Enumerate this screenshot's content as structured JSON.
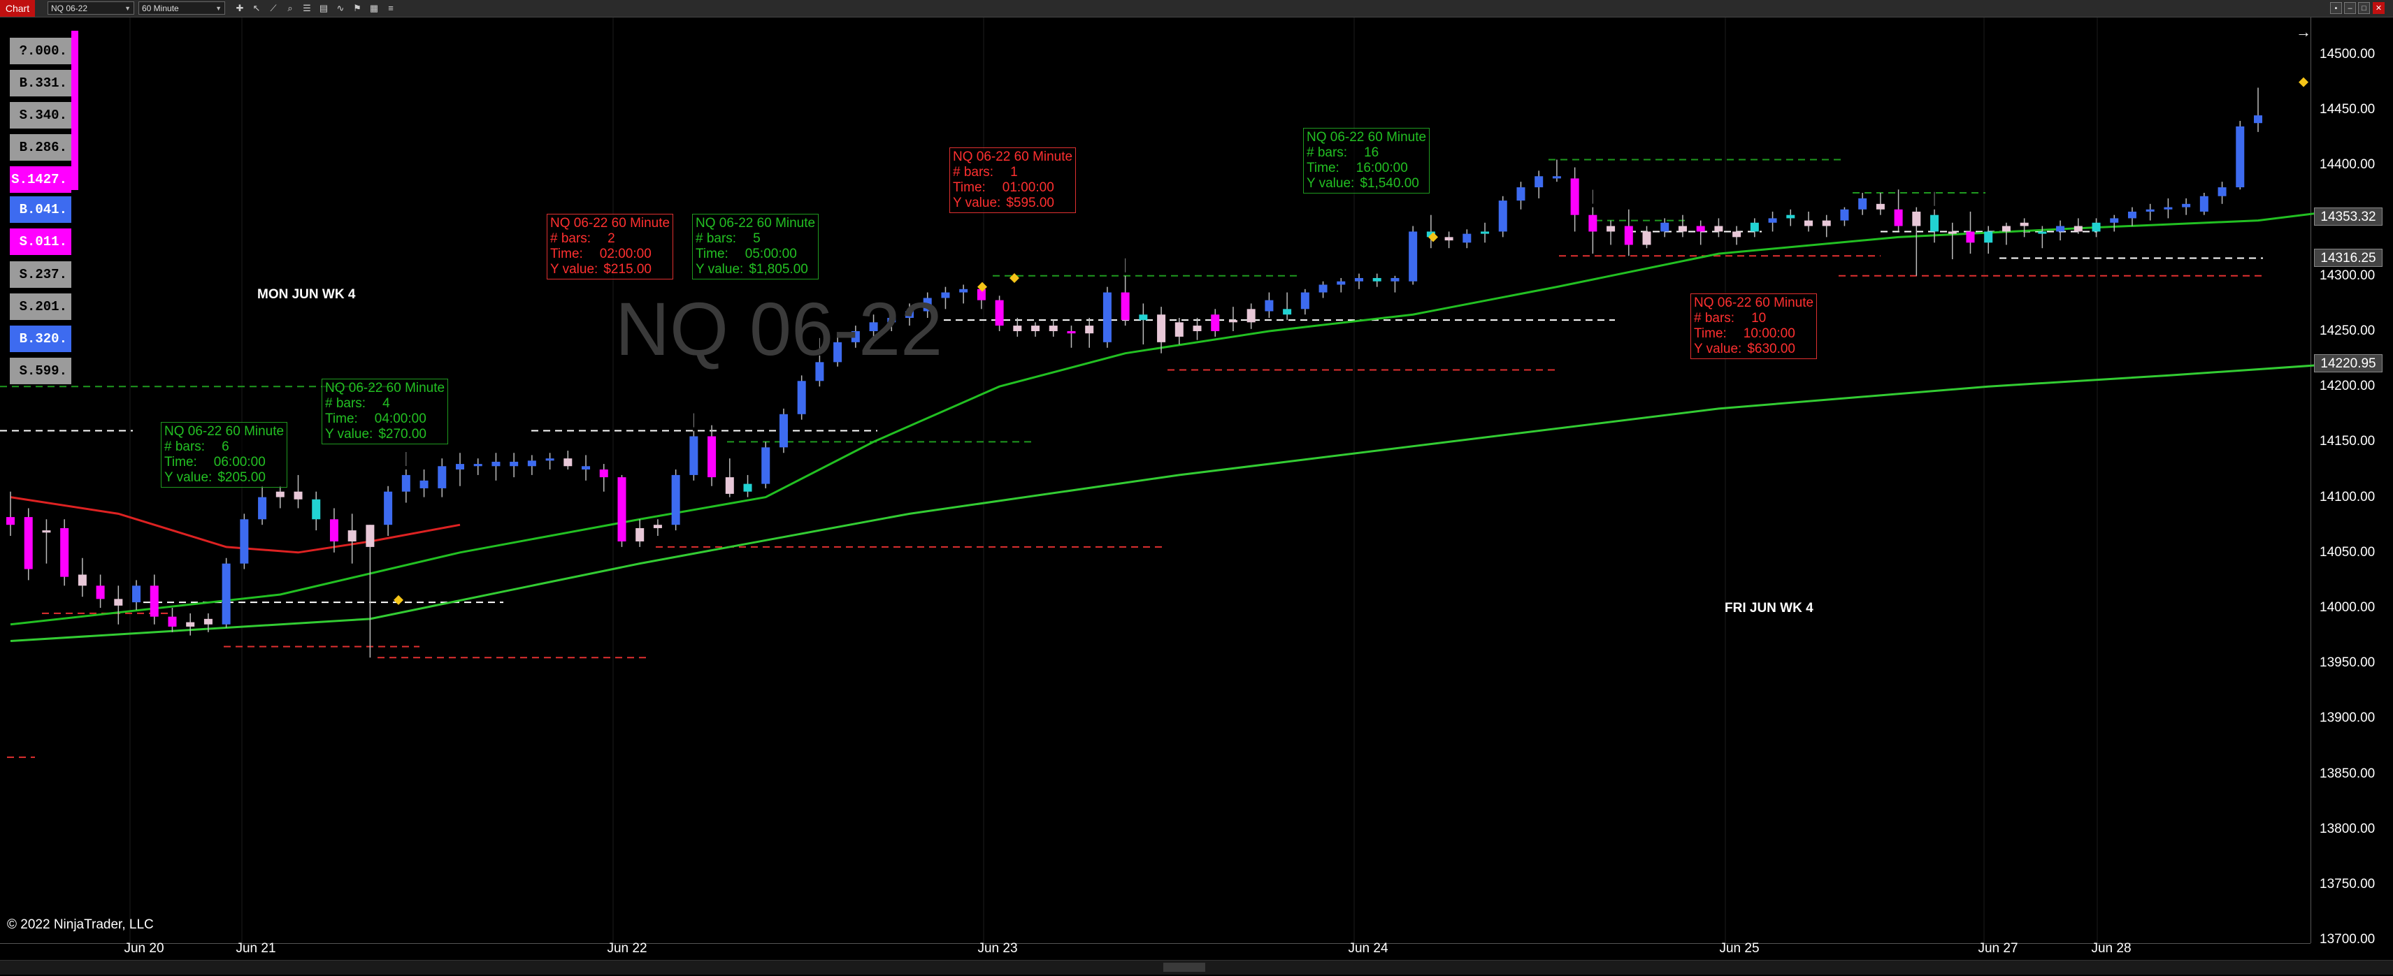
{
  "toolbar": {
    "tab_label": "Chart",
    "instrument": "NQ 06-22",
    "interval": "60 Minute",
    "tools": [
      "crosshair-icon",
      "pointer-icon",
      "draw-line-icon",
      "zoom-icon",
      "properties-icon",
      "data-series-icon",
      "indicators-icon",
      "strategies-icon",
      "templates-icon",
      "menu-icon"
    ]
  },
  "order_panel": [
    {
      "label": "?.000.",
      "type": "sell"
    },
    {
      "label": "B.331.",
      "type": "sell"
    },
    {
      "label": "S.340.",
      "type": "sell"
    },
    {
      "label": "B.286.",
      "type": "sell"
    },
    {
      "label": "S.1427.",
      "type": "magenta"
    },
    {
      "label": "B.041.",
      "type": "buy"
    },
    {
      "label": "S.011.",
      "type": "magenta"
    },
    {
      "label": "S.237.",
      "type": "sell"
    },
    {
      "label": "S.201.",
      "type": "sell"
    },
    {
      "label": "B.320.",
      "type": "buy"
    },
    {
      "label": "S.599.",
      "type": "sell"
    }
  ],
  "watermark": "NQ 06-22",
  "day_labels": [
    {
      "text": "MON JUN WK 4"
    },
    {
      "text": "FRI  JUN WK 4"
    }
  ],
  "annotations": [
    {
      "instrument": "NQ 06-22 60 Minute",
      "bars_label": "# bars:",
      "bars": "6",
      "time_label": "Time:",
      "time": "06:00:00",
      "y_label": "Y value:",
      "y": "$205.00",
      "color": "green"
    },
    {
      "instrument": "NQ 06-22 60 Minute",
      "bars_label": "# bars:",
      "bars": "4",
      "time_label": "Time:",
      "time": "04:00:00",
      "y_label": "Y value:",
      "y": "$270.00",
      "color": "green"
    },
    {
      "instrument": "NQ 06-22 60 Minute",
      "bars_label": "# bars:",
      "bars": "2",
      "time_label": "Time:",
      "time": "02:00:00",
      "y_label": "Y value:",
      "y": "$215.00",
      "color": "red"
    },
    {
      "instrument": "NQ 06-22 60 Minute",
      "bars_label": "# bars:",
      "bars": "5",
      "time_label": "Time:",
      "time": "05:00:00",
      "y_label": "Y value:",
      "y": "$1,805.00",
      "color": "green"
    },
    {
      "instrument": "NQ 06-22 60 Minute",
      "bars_label": "# bars:",
      "bars": "1",
      "time_label": "Time:",
      "time": "01:00:00",
      "y_label": "Y value:",
      "y": "$595.00",
      "color": "red"
    },
    {
      "instrument": "NQ 06-22 60 Minute",
      "bars_label": "# bars:",
      "bars": "16",
      "time_label": "Time:",
      "time": "16:00:00",
      "y_label": "Y value:",
      "y": "$1,540.00",
      "color": "green"
    },
    {
      "instrument": "NQ 06-22 60 Minute",
      "bars_label": "# bars:",
      "bars": "10",
      "time_label": "Time:",
      "time": "10:00:00",
      "y_label": "Y value:",
      "y": "$630.00",
      "color": "red"
    }
  ],
  "copyright": "© 2022 NinjaTrader, LLC",
  "x_axis": [
    "Jun 20",
    "Jun 21",
    "Jun 22",
    "Jun 23",
    "Jun 24",
    "Jun 25",
    "Jun 27",
    "Jun 28"
  ],
  "price_axis": [
    "14500.00",
    "14450.00",
    "14400.00",
    "14350.00",
    "14300.00",
    "14250.00",
    "14200.00",
    "14150.00",
    "14100.00",
    "14050.00",
    "14000.00",
    "13950.00",
    "13900.00",
    "13850.00",
    "13800.00",
    "13750.00",
    "13700.00"
  ],
  "price_tags": [
    "14353.32",
    "14316.25",
    "14220.95"
  ],
  "colors": {
    "up": "#3d6bf0",
    "down": "#ff00ff",
    "doji_light": "#e8c8d8",
    "teal": "#22d3d3",
    "ema_fast": "#22c022",
    "ema_red": "#dd2222",
    "ema_slow": "#33cc33"
  },
  "chart_data": {
    "type": "candlestick",
    "instrument": "NQ 06-22",
    "interval": "60 Minute",
    "ylim": [
      13700,
      14525
    ],
    "candles": [
      [
        14075,
        14105,
        14065,
        14082,
        "down"
      ],
      [
        14082,
        14090,
        14025,
        14035,
        "down"
      ],
      [
        14070,
        14080,
        14040,
        14068,
        "light"
      ],
      [
        14072,
        14080,
        14020,
        14028,
        "down"
      ],
      [
        14030,
        14045,
        14010,
        14020,
        "light"
      ],
      [
        14020,
        14030,
        14000,
        14008,
        "down"
      ],
      [
        14008,
        14020,
        13985,
        14002,
        "light"
      ],
      [
        14005,
        14025,
        13998,
        14020,
        "up"
      ],
      [
        14020,
        14030,
        13985,
        13992,
        "down"
      ],
      [
        13992,
        14000,
        13978,
        13983,
        "down"
      ],
      [
        13983,
        13995,
        13975,
        13987,
        "light"
      ],
      [
        13985,
        13995,
        13978,
        13990,
        "light"
      ],
      [
        13985,
        14045,
        13982,
        14040,
        "up"
      ],
      [
        14040,
        14085,
        14035,
        14080,
        "up"
      ],
      [
        14080,
        14110,
        14075,
        14100,
        "up"
      ],
      [
        14100,
        14110,
        14090,
        14105,
        "light"
      ],
      [
        14105,
        14120,
        14090,
        14098,
        "light"
      ],
      [
        14098,
        14105,
        14070,
        14080,
        "teal"
      ],
      [
        14080,
        14090,
        14050,
        14060,
        "down"
      ],
      [
        14060,
        14085,
        14040,
        14070,
        "light"
      ],
      [
        14055,
        14075,
        13955,
        14075,
        "light"
      ],
      [
        14075,
        14110,
        14065,
        14105,
        "up"
      ],
      [
        14105,
        14125,
        14095,
        14120,
        "up"
      ],
      [
        14115,
        14125,
        14100,
        14108,
        "up"
      ],
      [
        14108,
        14135,
        14100,
        14128,
        "up"
      ],
      [
        14125,
        14140,
        14110,
        14130,
        "up"
      ],
      [
        14130,
        14135,
        14120,
        14128,
        "up"
      ],
      [
        14128,
        14140,
        14115,
        14132,
        "up"
      ],
      [
        14132,
        14140,
        14118,
        14128,
        "up"
      ],
      [
        14128,
        14138,
        14120,
        14133,
        "up"
      ],
      [
        14133,
        14140,
        14125,
        14135,
        "up"
      ],
      [
        14135,
        14142,
        14125,
        14128,
        "light"
      ],
      [
        14128,
        14138,
        14115,
        14125,
        "up"
      ],
      [
        14125,
        14130,
        14105,
        14118,
        "down"
      ],
      [
        14118,
        14120,
        14055,
        14060,
        "down"
      ],
      [
        14060,
        14080,
        14055,
        14072,
        "light"
      ],
      [
        14072,
        14080,
        14065,
        14075,
        "light"
      ],
      [
        14075,
        14125,
        14070,
        14120,
        "up"
      ],
      [
        14120,
        14160,
        14115,
        14155,
        "up"
      ],
      [
        14155,
        14165,
        14110,
        14118,
        "down"
      ],
      [
        14118,
        14135,
        14100,
        14103,
        "light"
      ],
      [
        14105,
        14120,
        14100,
        14112,
        "teal"
      ],
      [
        14112,
        14150,
        14108,
        14145,
        "up"
      ],
      [
        14145,
        14180,
        14140,
        14175,
        "up"
      ],
      [
        14175,
        14210,
        14170,
        14205,
        "up"
      ],
      [
        14205,
        14228,
        14200,
        14222,
        "up"
      ],
      [
        14222,
        14245,
        14218,
        14240,
        "up"
      ],
      [
        14240,
        14255,
        14235,
        14250,
        "up"
      ],
      [
        14250,
        14265,
        14245,
        14258,
        "up"
      ],
      [
        14258,
        14270,
        14250,
        14262,
        "up"
      ],
      [
        14262,
        14275,
        14255,
        14268,
        "up"
      ],
      [
        14268,
        14285,
        14262,
        14280,
        "up"
      ],
      [
        14280,
        14290,
        14270,
        14285,
        "up"
      ],
      [
        14285,
        14292,
        14275,
        14288,
        "up"
      ],
      [
        14288,
        14292,
        14270,
        14278,
        "down"
      ],
      [
        14278,
        14282,
        14250,
        14255,
        "down"
      ],
      [
        14255,
        14262,
        14245,
        14250,
        "light"
      ],
      [
        14250,
        14258,
        14245,
        14255,
        "light"
      ],
      [
        14255,
        14260,
        14245,
        14250,
        "light"
      ],
      [
        14250,
        14255,
        14235,
        14248,
        "down"
      ],
      [
        14248,
        14262,
        14235,
        14255,
        "light"
      ],
      [
        14240,
        14290,
        14235,
        14285,
        "up"
      ],
      [
        14285,
        14300,
        14255,
        14260,
        "down"
      ],
      [
        14260,
        14275,
        14238,
        14265,
        "teal"
      ],
      [
        14265,
        14272,
        14230,
        14240,
        "light"
      ],
      [
        14245,
        14262,
        14238,
        14258,
        "light"
      ],
      [
        14255,
        14262,
        14242,
        14250,
        "light"
      ],
      [
        14250,
        14270,
        14245,
        14265,
        "down"
      ],
      [
        14258,
        14272,
        14250,
        14260,
        "light"
      ],
      [
        14258,
        14275,
        14252,
        14270,
        "light"
      ],
      [
        14268,
        14285,
        14262,
        14278,
        "up"
      ],
      [
        14270,
        14285,
        14260,
        14265,
        "teal"
      ],
      [
        14270,
        14288,
        14265,
        14285,
        "up"
      ],
      [
        14285,
        14295,
        14280,
        14292,
        "up"
      ],
      [
        14292,
        14298,
        14285,
        14295,
        "up"
      ],
      [
        14295,
        14302,
        14288,
        14298,
        "up"
      ],
      [
        14298,
        14302,
        14290,
        14295,
        "teal"
      ],
      [
        14295,
        14300,
        14285,
        14298,
        "up"
      ],
      [
        14295,
        14345,
        14292,
        14340,
        "up"
      ],
      [
        14340,
        14355,
        14325,
        14335,
        "teal"
      ],
      [
        14332,
        14340,
        14325,
        14335,
        "light"
      ],
      [
        14330,
        14342,
        14325,
        14338,
        "up"
      ],
      [
        14338,
        14348,
        14330,
        14340,
        "teal"
      ],
      [
        14340,
        14372,
        14335,
        14368,
        "up"
      ],
      [
        14368,
        14385,
        14360,
        14380,
        "up"
      ],
      [
        14380,
        14395,
        14370,
        14390,
        "up"
      ],
      [
        14390,
        14405,
        14385,
        14388,
        "up"
      ],
      [
        14388,
        14398,
        14340,
        14355,
        "down"
      ],
      [
        14355,
        14362,
        14320,
        14340,
        "down"
      ],
      [
        14340,
        14350,
        14328,
        14345,
        "light"
      ],
      [
        14345,
        14360,
        14318,
        14328,
        "down"
      ],
      [
        14328,
        14345,
        14325,
        14340,
        "light"
      ],
      [
        14340,
        14352,
        14335,
        14348,
        "up"
      ],
      [
        14345,
        14355,
        14335,
        14340,
        "light"
      ],
      [
        14340,
        14350,
        14328,
        14345,
        "down"
      ],
      [
        14345,
        14352,
        14335,
        14340,
        "light"
      ],
      [
        14335,
        14345,
        14328,
        14340,
        "light"
      ],
      [
        14340,
        14352,
        14335,
        14348,
        "teal"
      ],
      [
        14348,
        14358,
        14340,
        14352,
        "up"
      ],
      [
        14352,
        14360,
        14345,
        14355,
        "teal"
      ],
      [
        14350,
        14358,
        14340,
        14345,
        "light"
      ],
      [
        14345,
        14355,
        14335,
        14350,
        "light"
      ],
      [
        14350,
        14362,
        14345,
        14360,
        "up"
      ],
      [
        14360,
        14375,
        14355,
        14370,
        "up"
      ],
      [
        14365,
        14375,
        14355,
        14360,
        "light"
      ],
      [
        14360,
        14378,
        14340,
        14345,
        "down"
      ],
      [
        14345,
        14362,
        14300,
        14358,
        "light"
      ],
      [
        14355,
        14360,
        14330,
        14340,
        "teal"
      ],
      [
        14338,
        14348,
        14315,
        14340,
        "light"
      ],
      [
        14340,
        14358,
        14320,
        14330,
        "down"
      ],
      [
        14330,
        14345,
        14320,
        14340,
        "teal"
      ],
      [
        14340,
        14348,
        14328,
        14345,
        "light"
      ],
      [
        14345,
        14352,
        14335,
        14348,
        "light"
      ],
      [
        14338,
        14345,
        14325,
        14340,
        "teal"
      ],
      [
        14340,
        14350,
        14332,
        14345,
        "up"
      ],
      [
        14345,
        14352,
        14338,
        14340,
        "light"
      ],
      [
        14340,
        14352,
        14335,
        14348,
        "teal"
      ],
      [
        14348,
        14355,
        14340,
        14352,
        "up"
      ],
      [
        14352,
        14362,
        14345,
        14358,
        "up"
      ],
      [
        14358,
        14365,
        14350,
        14360,
        "up"
      ],
      [
        14360,
        14370,
        14352,
        14362,
        "up"
      ],
      [
        14362,
        14370,
        14355,
        14365,
        "up"
      ],
      [
        14358,
        14375,
        14355,
        14372,
        "up"
      ],
      [
        14372,
        14385,
        14365,
        14380,
        "up"
      ],
      [
        14380,
        14440,
        14378,
        14435,
        "up"
      ],
      [
        14438,
        14470,
        14430,
        14445,
        "up"
      ]
    ],
    "ema_fast": [
      [
        0,
        13985
      ],
      [
        15,
        14012
      ],
      [
        25,
        14050
      ],
      [
        35,
        14080
      ],
      [
        42,
        14100
      ],
      [
        48,
        14150
      ],
      [
        55,
        14200
      ],
      [
        62,
        14230
      ],
      [
        70,
        14250
      ],
      [
        78,
        14265
      ],
      [
        86,
        14290
      ],
      [
        95,
        14320
      ],
      [
        105,
        14335
      ],
      [
        115,
        14343
      ],
      [
        125,
        14350
      ],
      [
        129,
        14358
      ]
    ],
    "ema_red": [
      [
        0,
        14100
      ],
      [
        6,
        14085
      ],
      [
        12,
        14055
      ],
      [
        16,
        14050
      ],
      [
        20,
        14060
      ],
      [
        25,
        14075
      ]
    ],
    "ema_slow": [
      [
        0,
        13970
      ],
      [
        20,
        13990
      ],
      [
        35,
        14040
      ],
      [
        50,
        14085
      ],
      [
        65,
        14120
      ],
      [
        80,
        14150
      ],
      [
        95,
        14180
      ],
      [
        110,
        14200
      ],
      [
        120,
        14210
      ],
      [
        129,
        14220
      ]
    ]
  }
}
